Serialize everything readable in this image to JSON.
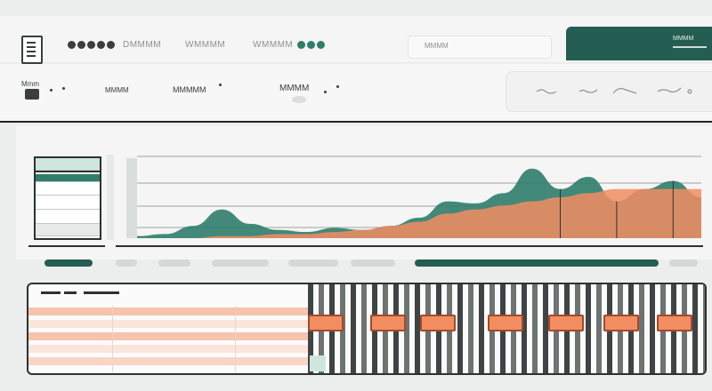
{
  "nav": {
    "brand_dots": [
      "#3a3e3d",
      "#3a3e3d",
      "#3a3e3d",
      "#3a3e3d",
      "#3a3e3d"
    ],
    "item1": "DMMMM",
    "item2": "WMMMM",
    "item3": "WMMMM",
    "status_dots": [
      "#2f7d6b",
      "#2f7d6b",
      "#2f7d6b"
    ],
    "search_text": "MMMM"
  },
  "user_panel": {
    "label": "MMMM"
  },
  "filters": {
    "f1": "Mmm",
    "f2": "MMMM",
    "f3": "MMMMM",
    "f4": "MMMM"
  },
  "colors": {
    "teal": "#2f7d6b",
    "dark_teal": "#245e53",
    "salmon": "#f28d62",
    "light_salmon": "#f6c3ab"
  },
  "chart_data": {
    "type": "area",
    "x": [
      0,
      1,
      2,
      3,
      4,
      5,
      6,
      7,
      8,
      9,
      10,
      11,
      12,
      13,
      14,
      15,
      16,
      17,
      18,
      19,
      20
    ],
    "series": [
      {
        "values": [
          1,
          2,
          6,
          14,
          7,
          4,
          3,
          5,
          4,
          6,
          10,
          18,
          17,
          22,
          34,
          24,
          30,
          18,
          24,
          28,
          20
        ]
      },
      {
        "values": [
          0,
          0,
          0,
          1,
          1,
          2,
          2,
          3,
          4,
          6,
          8,
          12,
          14,
          16,
          18,
          20,
          22,
          24,
          24,
          24,
          24
        ]
      }
    ],
    "grid": true,
    "ylim": [
      0,
      40
    ]
  }
}
